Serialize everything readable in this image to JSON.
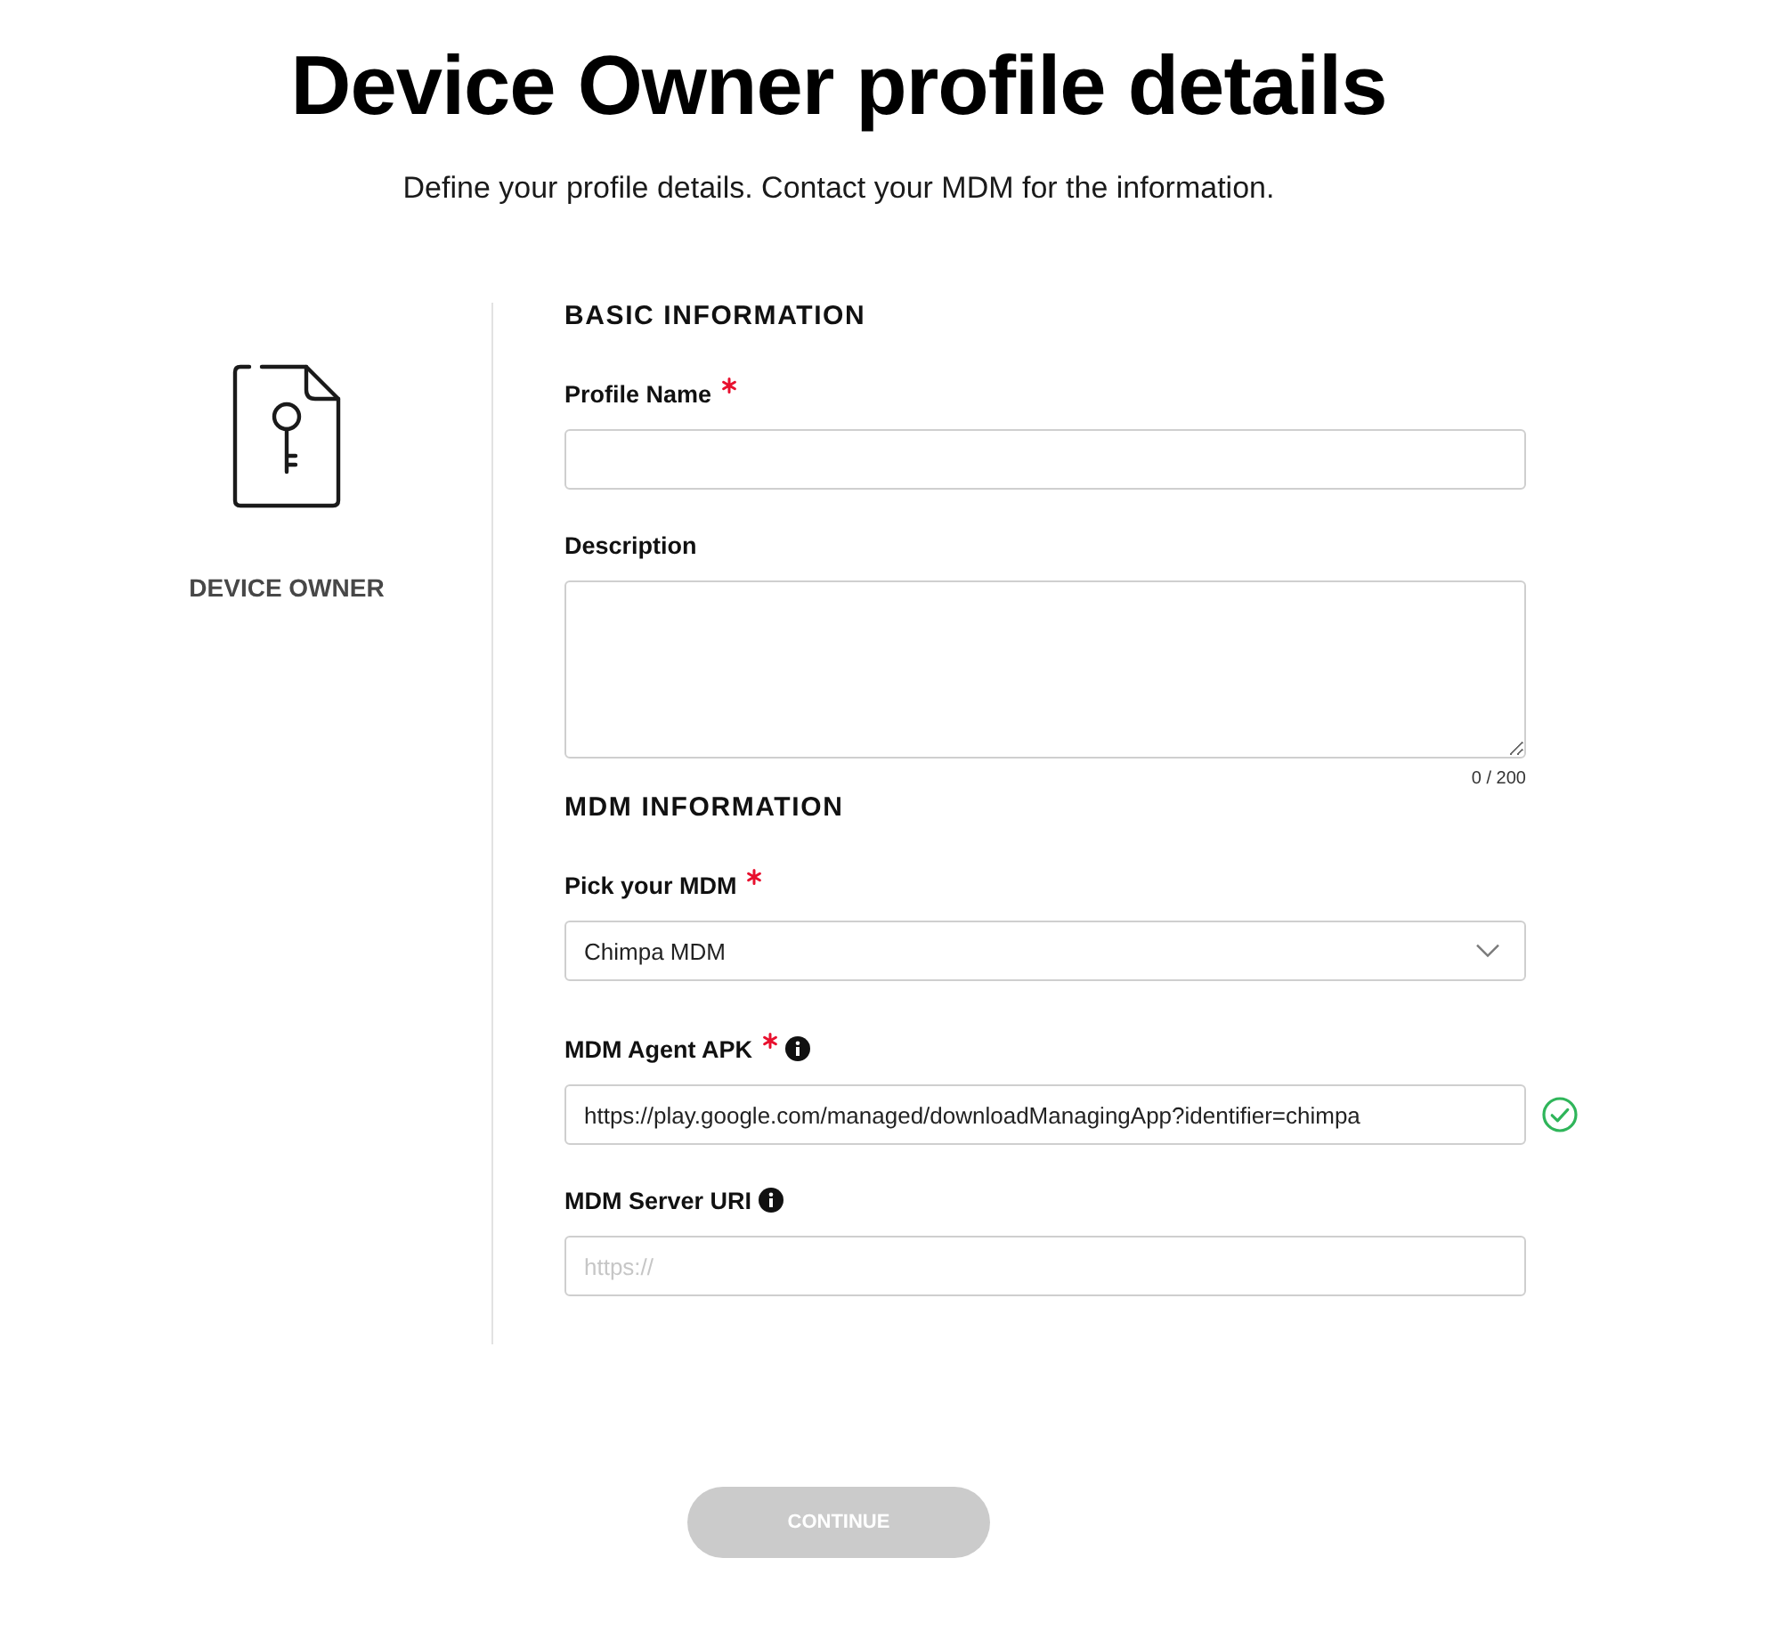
{
  "header": {
    "title": "Device Owner profile details",
    "subtitle": "Define your profile details. Contact your MDM for the information."
  },
  "profile_type": {
    "label": "DEVICE OWNER"
  },
  "sections": [
    {
      "heading": "BASIC INFORMATION",
      "fields": [
        {
          "kind": "text",
          "label": "Profile Name",
          "required": true,
          "info": false,
          "valid": false
        },
        {
          "kind": "textarea",
          "label": "Description",
          "required": false,
          "info": false,
          "valid": false,
          "counter": "0 / 200"
        }
      ]
    },
    {
      "heading": "MDM INFORMATION",
      "fields": [
        {
          "kind": "select",
          "label": "Pick your MDM",
          "required": true,
          "info": false,
          "valid": false,
          "value": "Chimpa MDM"
        },
        {
          "kind": "text",
          "label": "MDM Agent APK",
          "required": true,
          "info": true,
          "valid": true,
          "value": "https://play.google.com/managed/downloadManagingApp?identifier=chimpa"
        },
        {
          "kind": "text",
          "label": "MDM Server URI",
          "required": false,
          "info": true,
          "valid": false,
          "placeholder": "https://"
        }
      ]
    }
  ],
  "continue_button": {
    "label": "CONTINUE",
    "disabled": true
  }
}
